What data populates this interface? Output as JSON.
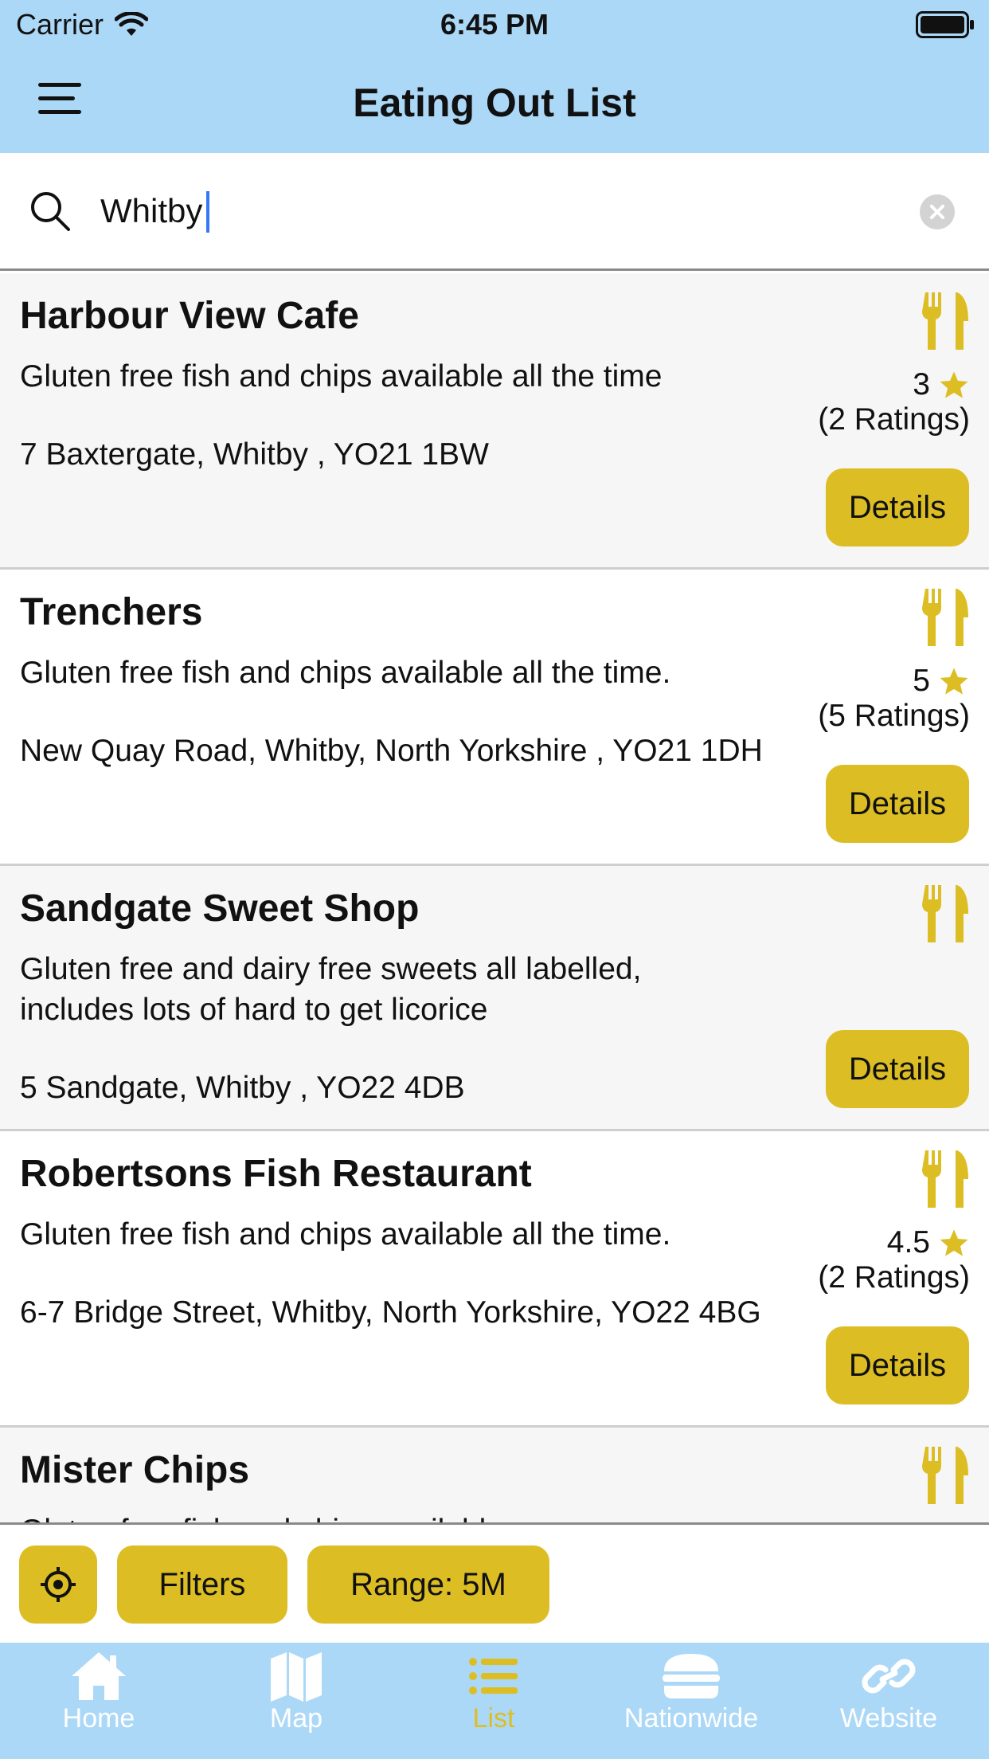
{
  "status_bar": {
    "carrier": "Carrier",
    "time": "6:45 PM"
  },
  "nav": {
    "title": "Eating Out List",
    "menu_icon": "hamburger-menu-icon"
  },
  "search": {
    "value": "Whitby",
    "placeholder": "",
    "search_icon": "search-icon",
    "clear_icon": "clear-icon"
  },
  "colors": {
    "nav_bg": "#acd8f7",
    "accent": "#dcbe24",
    "star": "#dcbe24",
    "row_alt": "#f6f6f6"
  },
  "restaurants": [
    {
      "name": "Harbour View Cafe",
      "description": "Gluten free fish and chips available all the time",
      "address": "7 Baxtergate, Whitby , YO21 1BW",
      "rating": "3",
      "ratings_count": "(2 Ratings)",
      "details_label": "Details",
      "icon": "fork-knife-icon"
    },
    {
      "name": "Trenchers",
      "description": "Gluten free fish and chips available all the time.",
      "address": "New Quay Road, Whitby, North Yorkshire , YO21 1DH",
      "rating": "5",
      "ratings_count": "(5 Ratings)",
      "details_label": "Details",
      "icon": "fork-knife-icon"
    },
    {
      "name": "Sandgate Sweet Shop",
      "description": "Gluten free and dairy free sweets all labelled, includes lots of hard to get licorice",
      "address": "5 Sandgate, Whitby , YO22 4DB",
      "rating": "",
      "ratings_count": "",
      "details_label": "Details",
      "icon": "fork-knife-icon"
    },
    {
      "name": "Robertsons Fish Restaurant",
      "description": "Gluten free fish and chips available all the time.",
      "address": "6-7 Bridge Street, Whitby, North Yorkshire, YO22 4BG",
      "rating": "4.5",
      "ratings_count": "(2 Ratings)",
      "details_label": "Details",
      "icon": "fork-knife-icon"
    },
    {
      "name": "Mister Chips",
      "description": "Gluten free fish and chips available",
      "icon": "fork-knife-icon"
    }
  ],
  "controls": {
    "locate_icon": "crosshair-icon",
    "filters_label": "Filters",
    "range_label": "Range: 5M"
  },
  "tabs": [
    {
      "label": "Home",
      "icon": "home-icon",
      "active": false
    },
    {
      "label": "Map",
      "icon": "map-icon",
      "active": false
    },
    {
      "label": "List",
      "icon": "list-icon",
      "active": true
    },
    {
      "label": "Nationwide",
      "icon": "burger-icon",
      "active": false
    },
    {
      "label": "Website",
      "icon": "link-icon",
      "active": false
    }
  ]
}
